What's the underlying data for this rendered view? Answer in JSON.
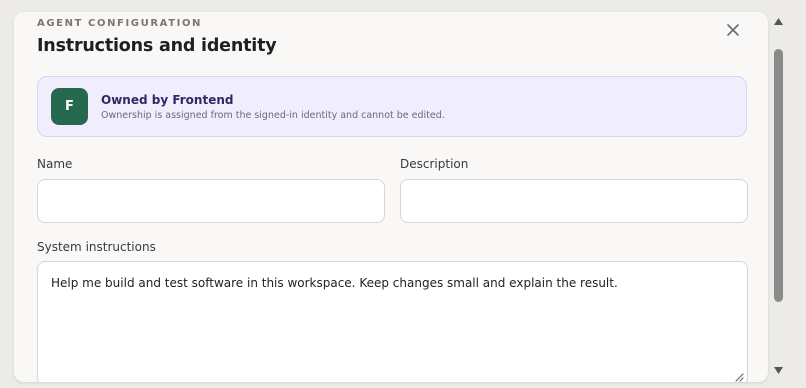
{
  "modal": {
    "eyebrow": "AGENT CONFIGURATION",
    "title": "Instructions and identity",
    "close_icon": "close-icon"
  },
  "owner": {
    "initial": "F",
    "title": "Owned by Frontend",
    "subtitle": "Ownership is assigned from the signed-in identity and cannot be edited.",
    "avatar_color": "#26694f",
    "card_color": "#f0eefc"
  },
  "fields": {
    "name": {
      "label": "Name",
      "value": ""
    },
    "description": {
      "label": "Description",
      "value": ""
    },
    "system_instructions": {
      "label": "System instructions",
      "value": "Help me build and test software in this workspace. Keep changes small and explain the result."
    }
  },
  "scrollbar": {
    "up_icon": "arrow-up-icon",
    "down_icon": "arrow-down-icon"
  }
}
